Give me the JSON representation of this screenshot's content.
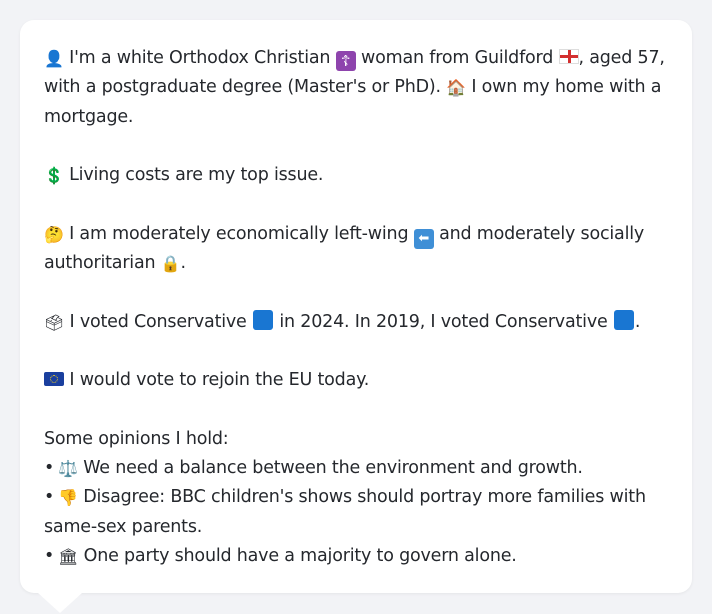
{
  "profile": {
    "line1_a": "I'm a white Orthodox Christian",
    "line1_b": "woman from Guildford",
    "line1_c": ", aged 57, with a postgraduate degree (Master's or PhD).",
    "line1_d": "I own my home with a mortgage.",
    "issue": "Living costs are my top issue.",
    "ideology_a": "I am moderately economically left-wing",
    "ideology_b": "and moderately socially authoritarian",
    "ideology_c": ".",
    "vote_a": "I voted Conservative",
    "vote_b": "in 2024. In 2019, I voted Conservative",
    "vote_c": ".",
    "eu": "I would vote to rejoin the EU today.",
    "opinions_heading": "Some opinions I hold:",
    "bullet": "•",
    "opinions": [
      "We need a balance between the environment and growth.",
      "Disagree: BBC children's shows should portray more families with same-sex parents.",
      "One party should have a majority to govern alone."
    ]
  },
  "icons": {
    "person": "👤",
    "cross": "☦",
    "house": "🏠",
    "dollar": "💲",
    "thinking": "🤔",
    "left_arrow": "⬅",
    "lock": "🔒",
    "ballot": "🗳",
    "scales": "⚖️",
    "thumbs_down": "👎",
    "classical_building": "🏛"
  },
  "colors": {
    "conservative_blue": "#1976d2",
    "card_bg": "#ffffff",
    "page_bg": "#f2f3f6",
    "text": "#25282d"
  }
}
